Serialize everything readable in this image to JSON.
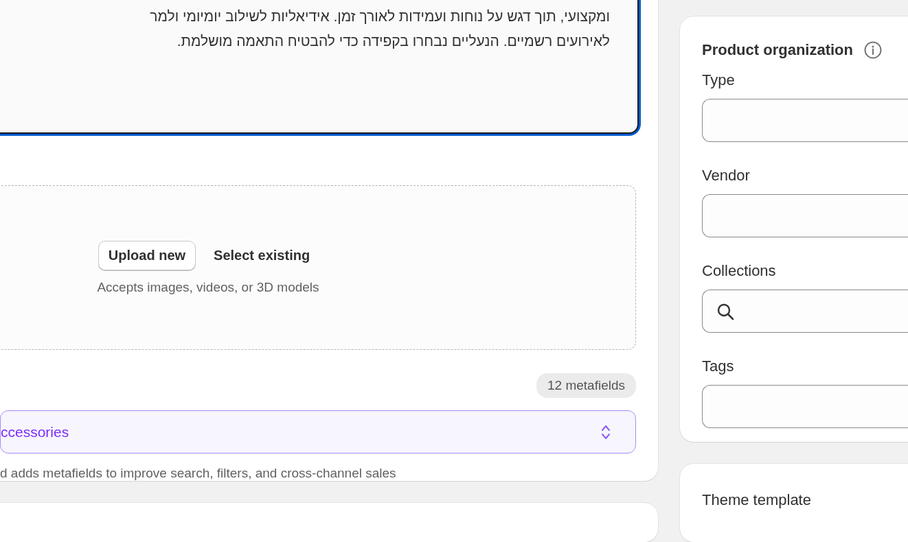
{
  "description": {
    "lines": [
      "ומקצועי, תוך דגש על נוחות ועמידות לאורך זמן. אידיאליות לשילוב יומיומי ולמר",
      "לאירועים רשמיים. הנעליים נבחרו בקפידה כדי להבטיח התאמה מושלמת."
    ],
    "focused": true
  },
  "media": {
    "buttons": [
      {
        "label": "Upload new",
        "kind": "outlined"
      },
      {
        "label": "Select existing",
        "kind": "plain"
      }
    ],
    "hint": "Accepts images, videos, or 3D models"
  },
  "metafields_badge": "12 metafields",
  "category": {
    "value": "ccessories",
    "hint": "d adds metafields to improve search, filters, and cross-channel sales"
  },
  "product_organization": {
    "title": "Product organization",
    "fields": [
      {
        "label": "Type",
        "kind": "text"
      },
      {
        "label": "Vendor",
        "kind": "text"
      },
      {
        "label": "Collections",
        "kind": "search"
      },
      {
        "label": "Tags",
        "kind": "text"
      }
    ]
  },
  "theme_template": {
    "title": "Theme template"
  }
}
